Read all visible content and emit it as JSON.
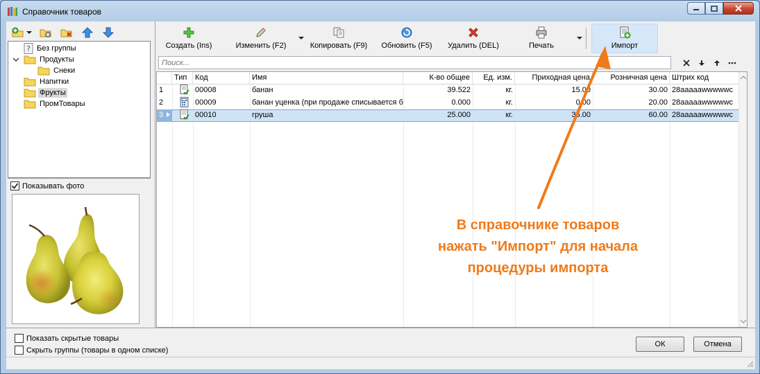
{
  "window": {
    "title": "Справочник товаров"
  },
  "tree": {
    "items": [
      {
        "label": "Без группы"
      },
      {
        "label": "Продукты"
      },
      {
        "label": "Снеки"
      },
      {
        "label": "Напитки"
      },
      {
        "label": "Фрукты"
      },
      {
        "label": "ПромТовары"
      }
    ]
  },
  "photo": {
    "show_photo_label": "Показывать фото",
    "show_photo_checked": true
  },
  "toolbar": {
    "create_label": "Создать (Ins)",
    "edit_label": "Изменить (F2)",
    "copy_label": "Копировать (F9)",
    "refresh_label": "Обновить (F5)",
    "delete_label": "Удалить (DEL)",
    "print_label": "Печать",
    "import_label": "Импорт"
  },
  "search": {
    "placeholder": "Поиск..."
  },
  "table": {
    "columns": [
      "Тип",
      "Код",
      "Имя",
      "К-во общее",
      "Ед. изм.",
      "Приходная цена",
      "Розничная цена",
      "Штрих код"
    ],
    "rows": [
      {
        "num": "1",
        "code": "00008",
        "name": "банан",
        "qty": "39.522",
        "unit": "кг.",
        "in_price": "15.00",
        "retail_price": "30.00",
        "barcode": "28aaaaawwwwwc"
      },
      {
        "num": "2",
        "code": "00009",
        "name": "банан уценка (при продаже списывается б",
        "qty": "0.000",
        "unit": "кг.",
        "in_price": "0.00",
        "retail_price": "20.00",
        "barcode": "28aaaaawwwwwc"
      },
      {
        "num": "3",
        "code": "00010",
        "name": "груша",
        "qty": "25.000",
        "unit": "кг.",
        "in_price": "35.00",
        "retail_price": "60.00",
        "barcode": "28aaaaawwwwwc"
      }
    ]
  },
  "options": {
    "show_hidden_label": "Показать скрытые товары",
    "hide_groups_label": "Скрыть группы (товары в одном списке)"
  },
  "buttons": {
    "ok_label": "ОК",
    "cancel_label": "Отмена"
  },
  "callout": {
    "line1": "В справочнике товаров",
    "line2": "нажать \"Импорт\" для начала",
    "line3": "процедуры импорта"
  },
  "colors": {
    "accent_orange": "#f07a1a",
    "selection": "#cfe3f7",
    "import_highlight": "#d5e7f8"
  }
}
